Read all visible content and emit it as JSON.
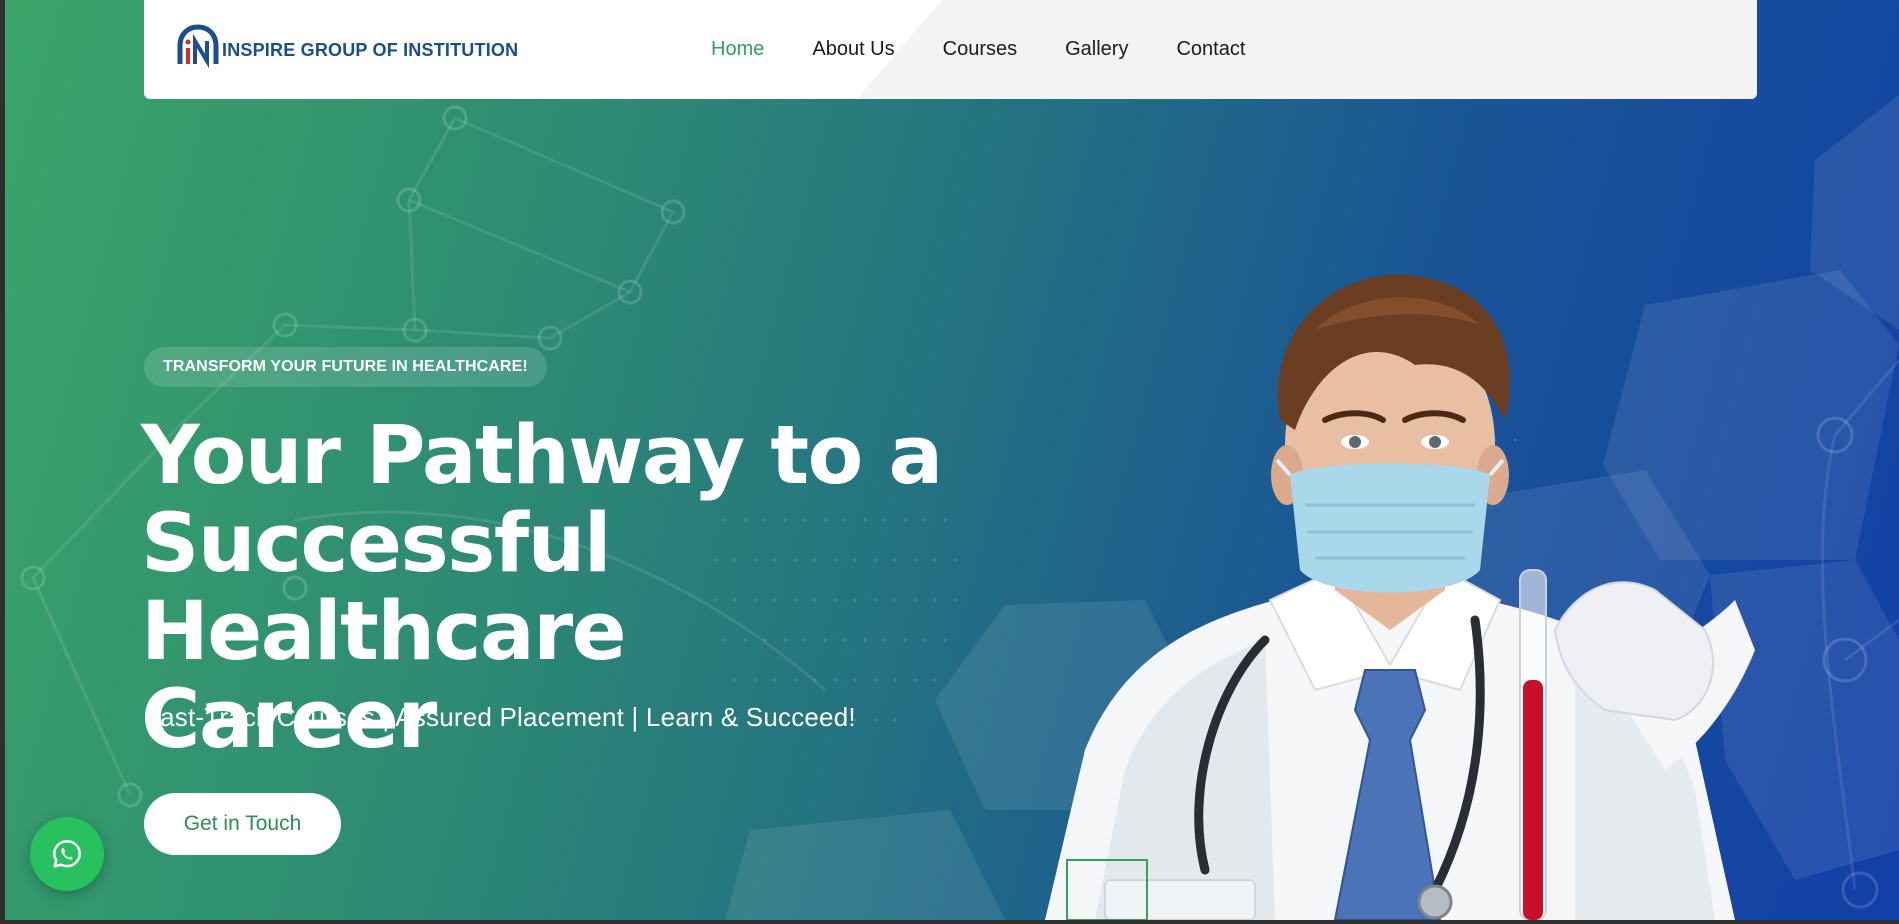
{
  "header": {
    "logo_text": "INSPIRE  GROUP OF INSTITUTION",
    "nav": [
      {
        "label": "Home",
        "active": true
      },
      {
        "label": "About Us"
      },
      {
        "label": "Courses"
      },
      {
        "label": "Gallery"
      },
      {
        "label": "Contact"
      }
    ]
  },
  "hero": {
    "tagline": "TRANSFORM YOUR FUTURE IN HEALTHCARE!",
    "headline_lines": [
      "Your Pathway to a",
      "Successful Healthcare",
      "Career"
    ],
    "subline": "Fast-Track Courses | Assured Placement | Learn & Succeed!",
    "cta_label": "Get in Touch",
    "image": "doctor-with-mask-holding-test-tube"
  },
  "floating": {
    "icon": "whatsapp-icon"
  },
  "colors": {
    "accent_green": "#2ea35d",
    "gradient_start": "#3aa569",
    "gradient_end": "#123fa8",
    "whatsapp": "#27c15f",
    "logo_blue": "#1b4e8c"
  }
}
